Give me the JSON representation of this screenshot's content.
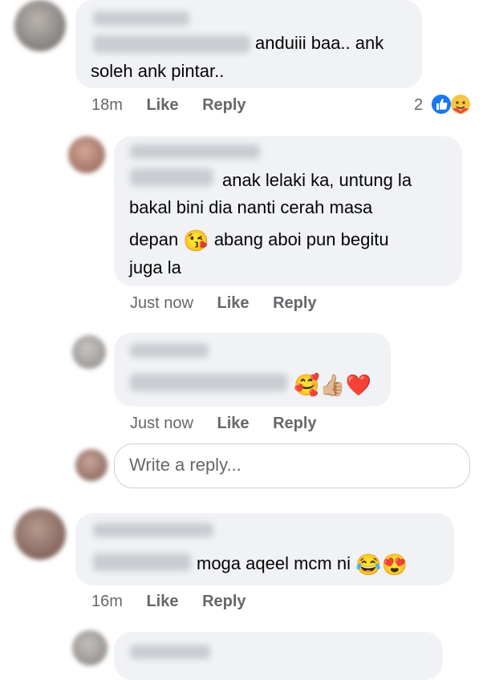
{
  "comments": [
    {
      "text_lines": [
        "anduiii baa.. ank",
        "soleh ank pintar.."
      ],
      "time": "18m",
      "like": "Like",
      "reply": "Reply",
      "reaction_count": "2",
      "reaction_icons": [
        "like-icon",
        "care-icon"
      ]
    },
    {
      "text_lines": [
        "anak lelaki ka, untung la",
        "bakal bini dia nanti cerah masa",
        "depan",
        "abang aboi pun begitu",
        "juga la"
      ],
      "emoji": "😘",
      "time": "Just now",
      "like": "Like",
      "reply": "Reply"
    },
    {
      "emojis": "🥰👍🏼❤️",
      "time": "Just now",
      "like": "Like",
      "reply": "Reply"
    },
    {
      "text": "moga aqeel mcm ni",
      "emojis": "😂😍",
      "time": "16m",
      "like": "Like",
      "reply": "Reply"
    }
  ],
  "reply_input": {
    "placeholder": "Write a reply..."
  },
  "colors": {
    "bubble": "#f0f2f5",
    "meta": "#65676b",
    "like_blue": "#1877f2"
  }
}
